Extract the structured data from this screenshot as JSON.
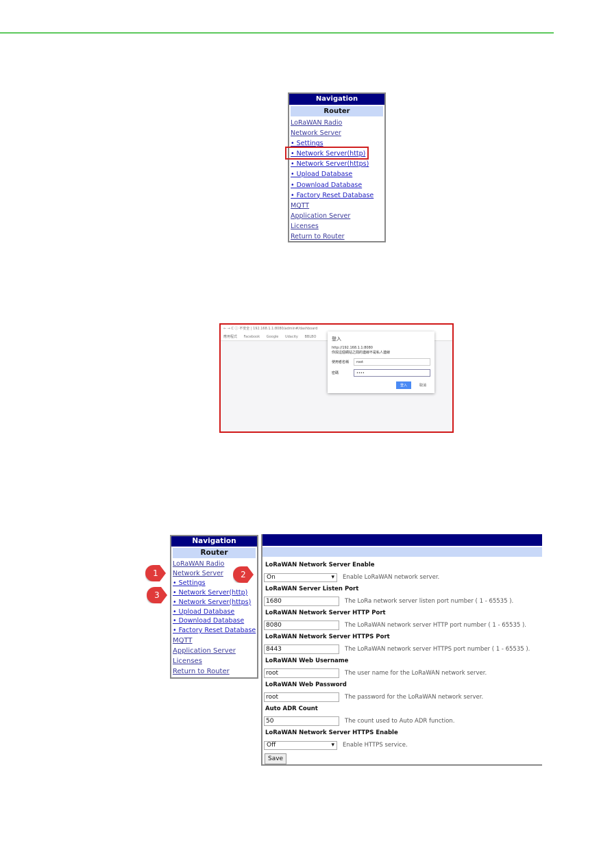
{
  "colors": {
    "rule": "#5cc85c",
    "nav_header": "#000080",
    "nav_sub": "#c8d8f8",
    "highlight": "#d02020",
    "callout": "#e03a3a"
  },
  "nav": {
    "title": "Navigation",
    "section": "Router",
    "items": [
      "LoRaWAN Radio",
      "Network Server",
      "• Settings",
      "• Network Server(http)",
      "• Network Server(https)",
      "• Upload Database",
      "• Download Database",
      "• Factory Reset Database",
      "MQTT",
      "Application Server",
      "Licenses",
      "Return to Router"
    ]
  },
  "login": {
    "address": "← → C  ⓘ 不安全 | 192.168.1.1:8080/admin#/dashboard",
    "bookmarks": [
      "應用程式",
      "Facebook",
      "Google",
      "Udacity",
      "BBLBO"
    ],
    "dialog_title": "登入",
    "dialog_url": "http://192.168.1.1:8080",
    "dialog_note": "你與這個網站之間的連線不是私人連線",
    "username_label": "使用者名稱",
    "username": "root",
    "password_label": "密碼",
    "password": "••••",
    "ok": "登入",
    "cancel": "取消"
  },
  "callouts": [
    "1",
    "2",
    "3"
  ],
  "form": {
    "fields": [
      {
        "label": "LoRaWAN Network Server Enable",
        "value": "On",
        "type": "select",
        "hint": "Enable LoRaWAN network server."
      },
      {
        "label": "LoRaWAN Server Listen Port",
        "value": "1680",
        "type": "input",
        "hint": "The LoRa network server listen port number ( 1 - 65535 )."
      },
      {
        "label": "LoRaWAN Network Server HTTP Port",
        "value": "8080",
        "type": "input",
        "hint": "The LoRaWAN network server HTTP port number ( 1 - 65535 )."
      },
      {
        "label": "LoRaWAN Network Server HTTPS Port",
        "value": "8443",
        "type": "input",
        "hint": "The LoRaWAN network server HTTPS port number ( 1 - 65535 )."
      },
      {
        "label": "LoRaWAN Web Username",
        "value": "root",
        "type": "input",
        "hint": "The user name for the LoRaWAN network server."
      },
      {
        "label": "LoRaWAN Web Password",
        "value": "root",
        "type": "input",
        "hint": "The password for the LoRaWAN network server."
      },
      {
        "label": "Auto ADR Count",
        "value": "50",
        "type": "input",
        "hint": "The count used to Auto ADR function."
      },
      {
        "label": "LoRaWAN Network Server HTTPS Enable",
        "value": "Off",
        "type": "select",
        "hint": "Enable HTTPS service."
      }
    ],
    "save": "Save"
  }
}
